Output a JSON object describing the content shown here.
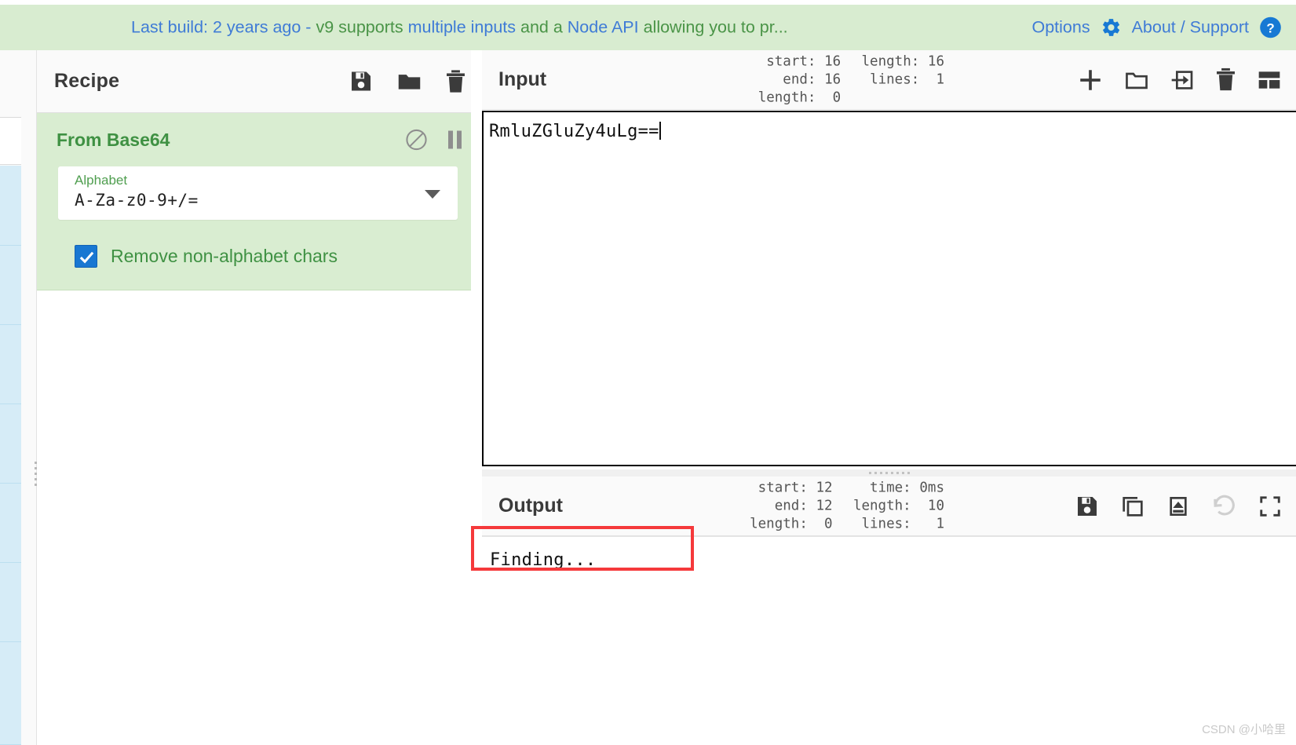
{
  "banner": {
    "notice_segments": [
      {
        "text": "Last build: 2 years ago - ",
        "color": "blue"
      },
      {
        "text": "v9 supports ",
        "color": "green"
      },
      {
        "text": "multiple inputs ",
        "color": "blue"
      },
      {
        "text": "and a ",
        "color": "green"
      },
      {
        "text": "Node API ",
        "color": "blue"
      },
      {
        "text": "allowing you to pr...",
        "color": "green"
      }
    ],
    "notice_full": "Last build: 2 years ago - v9 supports multiple inputs and a Node API allowing you to pr...",
    "options_label": "Options",
    "about_label": "About / Support",
    "gear_icon": "gear-icon",
    "help_icon": "help-circle-icon",
    "background_color": "#d8ecd0",
    "link_color": "#3f7bd6",
    "green_color": "#4a9447"
  },
  "recipe": {
    "title": "Recipe",
    "icons": [
      {
        "name": "save-recipe-icon",
        "glyph": "floppy-disk"
      },
      {
        "name": "load-recipe-icon",
        "glyph": "folder"
      },
      {
        "name": "clear-recipe-icon",
        "glyph": "trash"
      }
    ],
    "operation": {
      "name": "From Base64",
      "disable_icon": "disable-icon",
      "breakpoint_icon": "pause-icon",
      "args": [
        {
          "label": "Alphabet",
          "value": "A-Za-z0-9+/=",
          "type": "select",
          "dropdown_icon": "chevron-down-icon"
        }
      ],
      "checkbox": {
        "label": "Remove non-alphabet chars",
        "checked": true,
        "accent_color": "#1877d2"
      },
      "background_color": "#d9edd1",
      "title_color": "#3f9143"
    }
  },
  "input": {
    "title": "Input",
    "stats": {
      "left": [
        {
          "key": "start:",
          "value": "16"
        },
        {
          "key": "end:",
          "value": "16"
        },
        {
          "key": "length:",
          "value": "0"
        }
      ],
      "right": [
        {
          "key": "length:",
          "value": "16"
        },
        {
          "key": "lines:",
          "value": "1"
        }
      ]
    },
    "value": "RmluZGluZy4uLg==",
    "icons": [
      {
        "name": "add-input-tab-icon",
        "glyph": "plus"
      },
      {
        "name": "open-folder-icon",
        "glyph": "folder-open"
      },
      {
        "name": "open-folder-as-input-icon",
        "glyph": "arrow-into-box"
      },
      {
        "name": "clear-input-icon",
        "glyph": "trash"
      },
      {
        "name": "reset-pane-layout-icon",
        "glyph": "panels"
      }
    ]
  },
  "output": {
    "title": "Output",
    "stats": {
      "left": [
        {
          "key": "start:",
          "value": "12"
        },
        {
          "key": "end:",
          "value": "12"
        },
        {
          "key": "length:",
          "value": "0"
        }
      ],
      "right": [
        {
          "key": "time:",
          "value": "0ms"
        },
        {
          "key": "length:",
          "value": "10"
        },
        {
          "key": "lines:",
          "value": "1"
        }
      ]
    },
    "value": "Finding...",
    "highlight_color": "#f5393b",
    "icons": [
      {
        "name": "save-output-icon",
        "glyph": "floppy-disk"
      },
      {
        "name": "copy-output-icon",
        "glyph": "copy"
      },
      {
        "name": "replace-input-with-output-icon",
        "glyph": "box-arrow-up"
      },
      {
        "name": "bake-undo-icon",
        "glyph": "undo-arrow"
      },
      {
        "name": "maximise-output-icon",
        "glyph": "expand"
      }
    ]
  },
  "operations_list": {
    "visible_rows": 7,
    "row_color": "#d6ecf7",
    "scrollbar_color": "#c6c6c6"
  },
  "watermark": "CSDN @小哈里"
}
